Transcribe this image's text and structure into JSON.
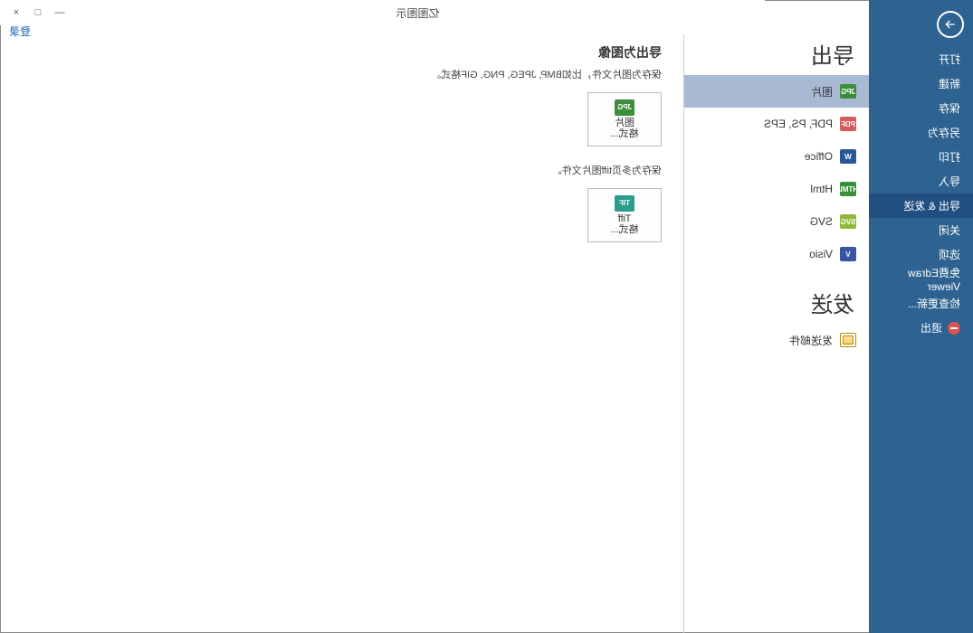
{
  "window": {
    "title": "亿图图示",
    "login": "登录"
  },
  "win_controls": {
    "min": "—",
    "max": "□",
    "close": "×"
  },
  "sidebar": {
    "items": [
      {
        "label": "打开"
      },
      {
        "label": "新建"
      },
      {
        "label": "保存"
      },
      {
        "label": "另存为"
      },
      {
        "label": "打印"
      },
      {
        "label": "导入"
      },
      {
        "label": "导出 & 发送",
        "selected": true
      },
      {
        "label": "关闭"
      },
      {
        "label": "选项"
      },
      {
        "label": "免费Edraw Viewer"
      },
      {
        "label": "检查更新..."
      },
      {
        "label": "退出",
        "icon": "exit"
      }
    ]
  },
  "export": {
    "heading": "导出",
    "send_heading": "发送",
    "categories": [
      {
        "label": "图片",
        "icon": "jpg",
        "selected": true
      },
      {
        "label": "PDF, PS, EPS",
        "icon": "pdf"
      },
      {
        "label": "Office",
        "icon": "word"
      },
      {
        "label": "Html",
        "icon": "html"
      },
      {
        "label": "SVG",
        "icon": "svg"
      },
      {
        "label": "Visio",
        "icon": "visio"
      }
    ],
    "send_items": [
      {
        "label": "发送邮件",
        "icon": "mail"
      }
    ]
  },
  "main": {
    "heading": "导出为图像",
    "desc1": "保存为图片文件，比如BMP, JPEG, PNG, GIF格式。",
    "card1": {
      "label1": "图片",
      "label2": "格式...",
      "icon": "jpg"
    },
    "desc2": "保存为多页tiff图片文件。",
    "card2": {
      "label1": "Tiff",
      "label2": "格式...",
      "icon": "tiff"
    }
  }
}
